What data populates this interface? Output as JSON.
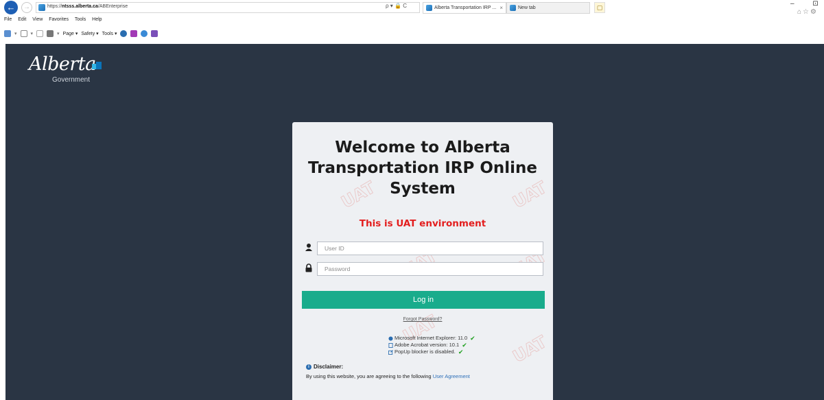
{
  "browser": {
    "url_prefix": "https://",
    "url_domain": "ntsss.alberta.ca",
    "url_path": "/ABEnterprise",
    "address_tools": "ρ ▾ 🔒 C",
    "tabs": [
      {
        "label": "Alberta Transportation IRP ...",
        "active": true
      },
      {
        "label": "New tab",
        "active": false
      }
    ],
    "menu": [
      "File",
      "Edit",
      "View",
      "Favorites",
      "Tools",
      "Help"
    ],
    "command_bar": [
      "Page ▾",
      "Safety ▾",
      "Tools ▾"
    ],
    "window_controls": "– ⊡",
    "fav_icons": "⌂☆⚙"
  },
  "branding": {
    "logo_word": "Alberta",
    "logo_sub": "Government"
  },
  "login": {
    "welcome_title": "Welcome to Alberta Transportation IRP Online System",
    "environment_notice": "This is UAT environment",
    "user_id_placeholder": "User ID",
    "password_placeholder": "Password",
    "login_label": "Log in",
    "forgot_password": "Forgot Password?",
    "checks": [
      {
        "text": "Microsoft Internet Explorer: 11.0",
        "icon": "ie-icon"
      },
      {
        "text": "Adobe Acrobat version: 10.1",
        "icon": "acrobat-icon"
      },
      {
        "text": "PopUp blocker is disabled.",
        "icon": "popup-icon"
      }
    ],
    "disclaimer_title": "Disclaimer:",
    "disclaimer_text": "By using this website, you are agreeing to the following",
    "user_agreement_link": "User Agreement",
    "watermark_text": "UAT"
  },
  "colors": {
    "page_background": "#2a3544",
    "login_button": "#19ac8c",
    "uat_red": "#e31e1e"
  }
}
